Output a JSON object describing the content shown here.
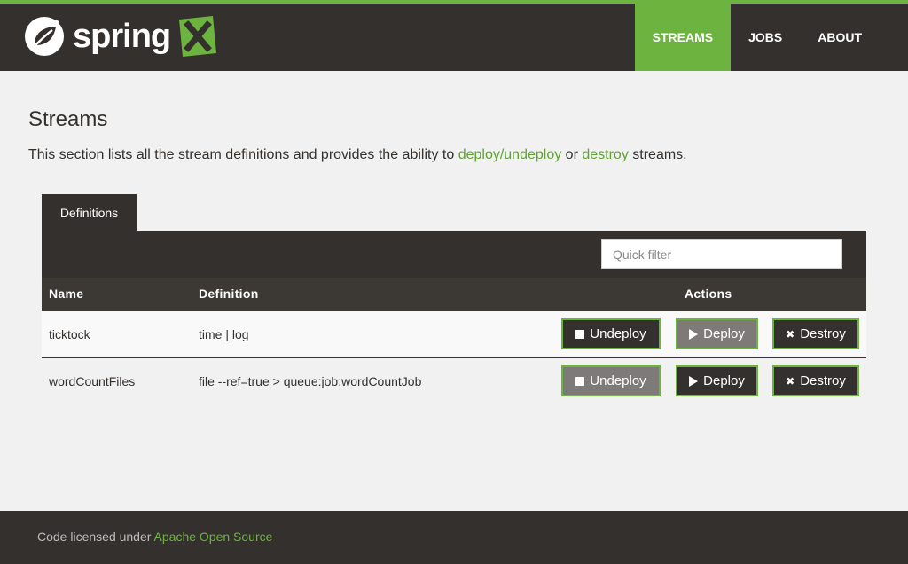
{
  "brand": {
    "logo_text": "spring",
    "colors": {
      "accent": "#6db33f",
      "dark": "#34302d",
      "bg": "#f1f1f1"
    }
  },
  "nav": {
    "items": [
      {
        "label": "STREAMS",
        "active": true
      },
      {
        "label": "JOBS",
        "active": false
      },
      {
        "label": "ABOUT",
        "active": false
      }
    ]
  },
  "page": {
    "title": "Streams",
    "intro_prefix": "This section lists all the stream definitions and provides the ability to ",
    "intro_link1": "deploy/undeploy",
    "intro_mid": " or ",
    "intro_link2": "destroy",
    "intro_suffix": " streams."
  },
  "tabs": [
    {
      "label": "Definitions"
    }
  ],
  "filter": {
    "placeholder": "Quick filter",
    "value": ""
  },
  "table": {
    "headers": {
      "name": "Name",
      "definition": "Definition",
      "actions": "Actions"
    },
    "rows": [
      {
        "name": "ticktock",
        "definition": "time | log",
        "deployed": true
      },
      {
        "name": "wordCountFiles",
        "definition": "file --ref=true > queue:job:wordCountJob",
        "deployed": false
      }
    ],
    "actions": {
      "undeploy": {
        "label": "Undeploy",
        "icon": "stop-icon"
      },
      "deploy": {
        "label": "Deploy",
        "icon": "play-icon"
      },
      "destroy": {
        "label": "Destroy",
        "icon": "x-icon"
      }
    }
  },
  "footer": {
    "text": "Code licensed under ",
    "link": "Apache Open Source"
  }
}
